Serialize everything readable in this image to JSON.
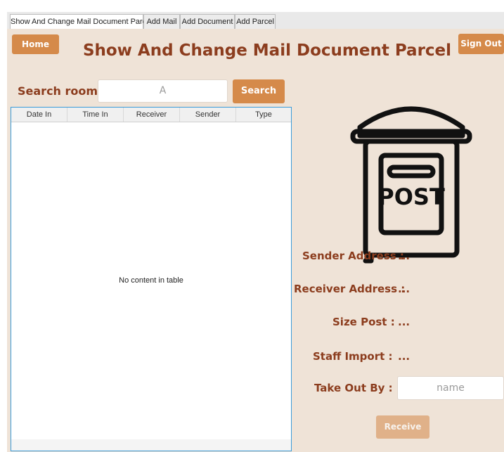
{
  "tabs": [
    {
      "label": "Show And Change Mail Document Parcel",
      "active": true
    },
    {
      "label": "Add Mail",
      "active": false
    },
    {
      "label": "Add Document",
      "active": false
    },
    {
      "label": "Add Parcel",
      "active": false
    }
  ],
  "header": {
    "home_label": "Home",
    "title": "Show And Change Mail Document Parcel",
    "signout_label": "Sign Out"
  },
  "search": {
    "label": "Search room :",
    "value": "A",
    "button_label": "Search"
  },
  "table": {
    "columns": [
      "Date In",
      "Time In",
      "Receiver",
      "Sender",
      "Type"
    ],
    "empty_text": "No content in table"
  },
  "mailbox": {
    "icon": "post-mailbox-icon",
    "text": "POST"
  },
  "details": {
    "sender_label": "Sender Address :",
    "sender_value": "...",
    "receiver_label": "Receiver Address :",
    "receiver_value": "...",
    "size_label": "Size Post :",
    "size_value": "...",
    "staff_label": "Staff Import :",
    "staff_value": "...",
    "takeout_label": "Take Out By :",
    "takeout_placeholder": "name",
    "receive_label": "Receive"
  },
  "colors": {
    "accent": "#d58a4a",
    "title": "#8c3d1e",
    "background": "#efe3d7",
    "table_border": "#3a9bd8"
  }
}
